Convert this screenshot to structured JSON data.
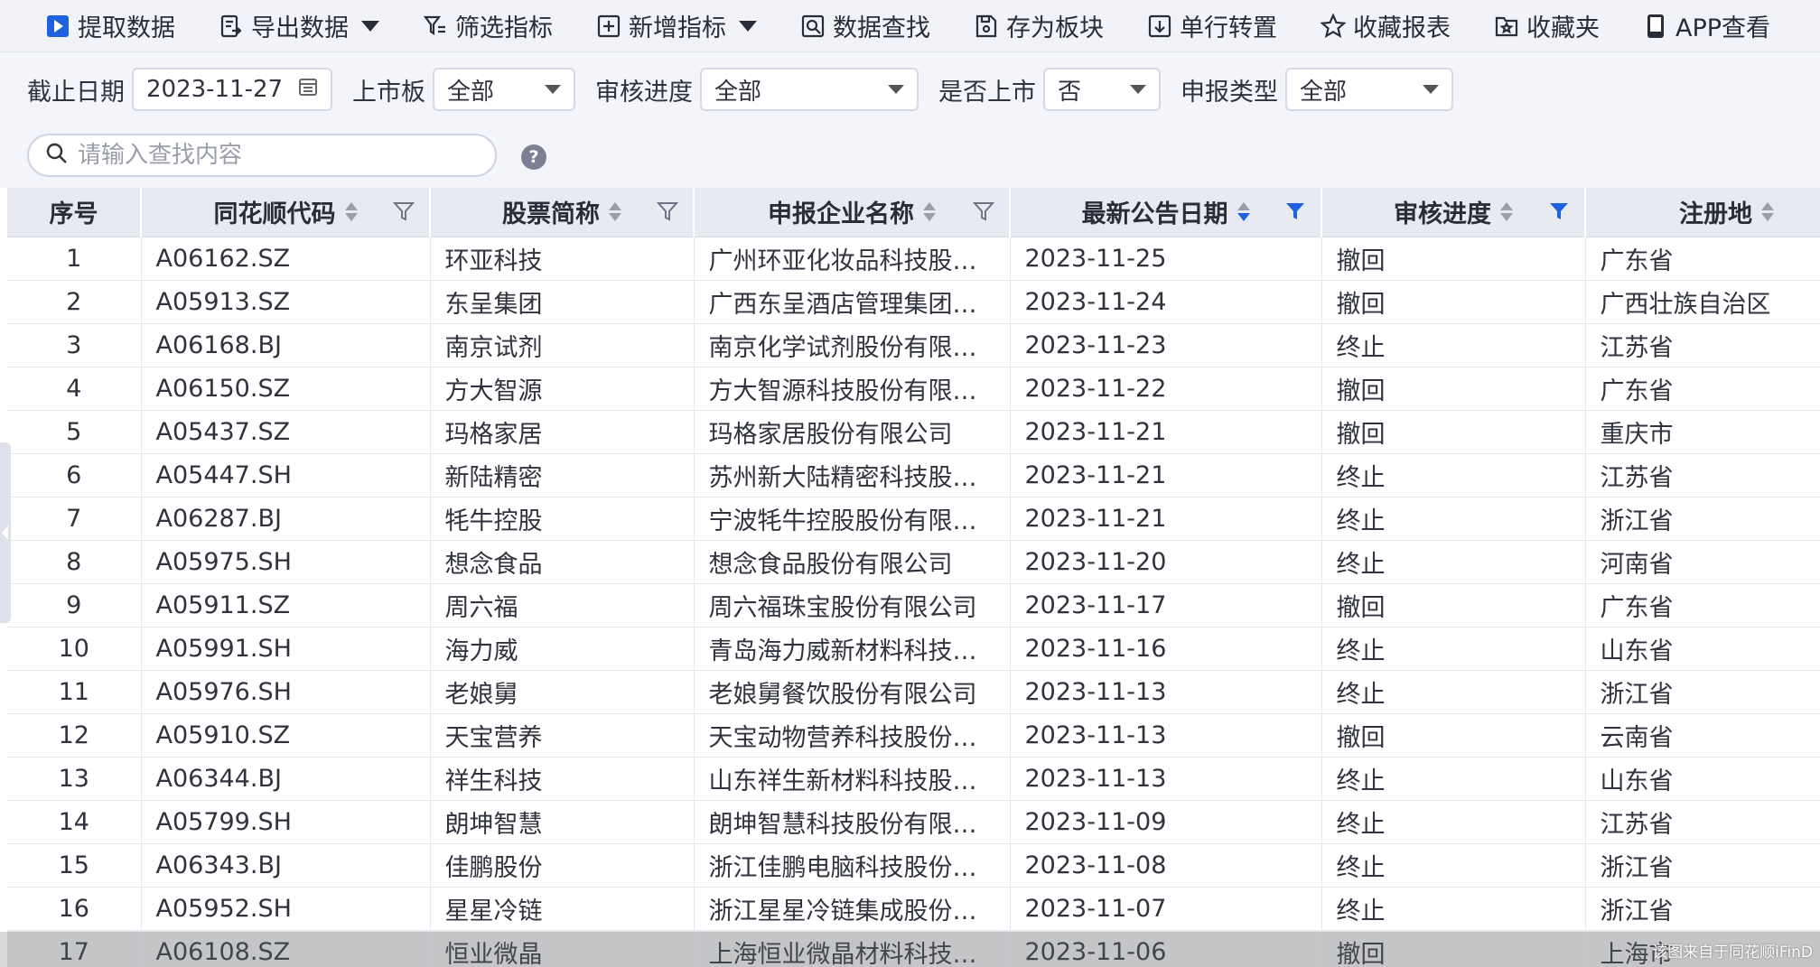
{
  "toolbar": {
    "items": [
      {
        "label": "提取数据",
        "icon": "play-icon"
      },
      {
        "label": "导出数据",
        "icon": "export-icon"
      },
      {
        "label": "筛选指标",
        "icon": "filter-icon"
      },
      {
        "label": "新增指标",
        "icon": "add-box-icon"
      },
      {
        "label": "数据查找",
        "icon": "find-icon"
      },
      {
        "label": "存为板块",
        "icon": "save-icon"
      },
      {
        "label": "单行转置",
        "icon": "transpose-icon"
      },
      {
        "label": "收藏报表",
        "icon": "star-icon"
      },
      {
        "label": "收藏夹",
        "icon": "folder-star-icon"
      },
      {
        "label": "APP查看",
        "icon": "phone-icon"
      }
    ]
  },
  "filters": {
    "date_label": "截止日期",
    "date_value": "2023-11-27",
    "board_label": "上市板",
    "board_value": "全部",
    "progress_label": "审核进度",
    "progress_value": "全部",
    "listed_label": "是否上市",
    "listed_value": "否",
    "type_label": "申报类型",
    "type_value": "全部"
  },
  "search": {
    "placeholder": "请输入查找内容",
    "help": "?"
  },
  "table": {
    "columns": [
      "序号",
      "同花顺代码",
      "股票简称",
      "申报企业名称",
      "最新公告日期",
      "审核进度",
      "注册地"
    ],
    "rows": [
      [
        "1",
        "A06162.SZ",
        "环亚科技",
        "广州环亚化妆品科技股…",
        "2023-11-25",
        "撤回",
        "广东省"
      ],
      [
        "2",
        "A05913.SZ",
        "东呈集团",
        "广西东呈酒店管理集团…",
        "2023-11-24",
        "撤回",
        "广西壮族自治区"
      ],
      [
        "3",
        "A06168.BJ",
        "南京试剂",
        "南京化学试剂股份有限…",
        "2023-11-23",
        "终止",
        "江苏省"
      ],
      [
        "4",
        "A06150.SZ",
        "方大智源",
        "方大智源科技股份有限…",
        "2023-11-22",
        "撤回",
        "广东省"
      ],
      [
        "5",
        "A05437.SZ",
        "玛格家居",
        "玛格家居股份有限公司",
        "2023-11-21",
        "撤回",
        "重庆市"
      ],
      [
        "6",
        "A05447.SH",
        "新陆精密",
        "苏州新大陆精密科技股…",
        "2023-11-21",
        "终止",
        "江苏省"
      ],
      [
        "7",
        "A06287.BJ",
        "牦牛控股",
        "宁波牦牛控股股份有限…",
        "2023-11-21",
        "终止",
        "浙江省"
      ],
      [
        "8",
        "A05975.SH",
        "想念食品",
        "想念食品股份有限公司",
        "2023-11-20",
        "终止",
        "河南省"
      ],
      [
        "9",
        "A05911.SZ",
        "周六福",
        "周六福珠宝股份有限公司",
        "2023-11-17",
        "撤回",
        "广东省"
      ],
      [
        "10",
        "A05991.SH",
        "海力威",
        "青岛海力威新材料科技…",
        "2023-11-16",
        "终止",
        "山东省"
      ],
      [
        "11",
        "A05976.SH",
        "老娘舅",
        "老娘舅餐饮股份有限公司",
        "2023-11-13",
        "终止",
        "浙江省"
      ],
      [
        "12",
        "A05910.SZ",
        "天宝营养",
        "天宝动物营养科技股份…",
        "2023-11-13",
        "撤回",
        "云南省"
      ],
      [
        "13",
        "A06344.BJ",
        "祥生科技",
        "山东祥生新材料科技股…",
        "2023-11-13",
        "终止",
        "山东省"
      ],
      [
        "14",
        "A05799.SH",
        "朗坤智慧",
        "朗坤智慧科技股份有限…",
        "2023-11-09",
        "终止",
        "江苏省"
      ],
      [
        "15",
        "A06343.BJ",
        "佳鹏股份",
        "浙江佳鹏电脑科技股份…",
        "2023-11-08",
        "终止",
        "浙江省"
      ],
      [
        "16",
        "A05952.SH",
        "星星冷链",
        "浙江星星冷链集成股份…",
        "2023-11-07",
        "终止",
        "浙江省"
      ],
      [
        "17",
        "A06108.SZ",
        "恒业微晶",
        "上海恒业微晶材料科技…",
        "2023-11-06",
        "撤回",
        "上海市"
      ]
    ]
  },
  "watermark": "该图来自于同花顺iFinD",
  "colors": {
    "accent": "#1e62e0",
    "header_bg": "#e8eaf2",
    "toolbar_bg": "#f2f3f8"
  }
}
